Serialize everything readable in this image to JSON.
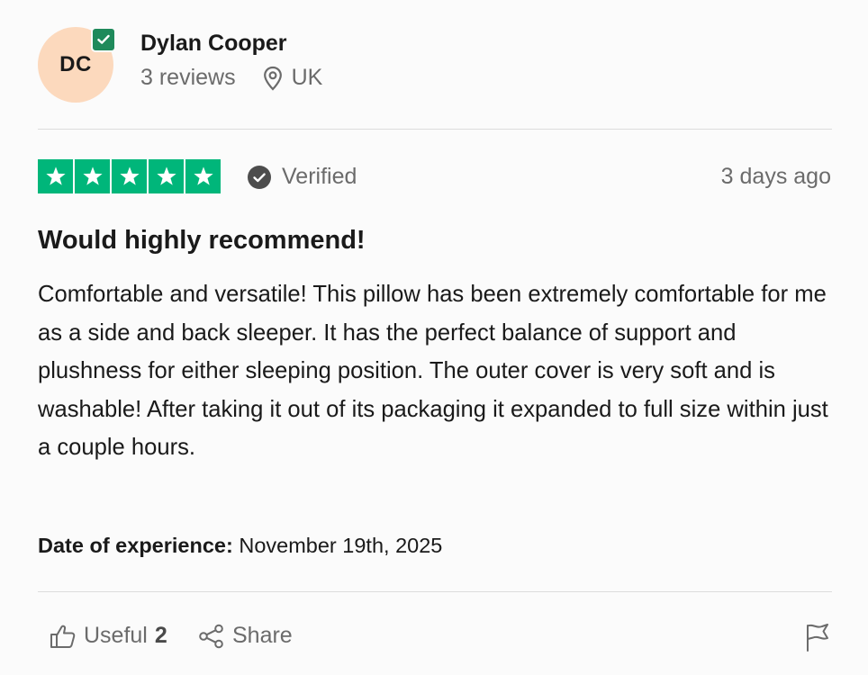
{
  "reviewer": {
    "initials": "DC",
    "name": "Dylan Cooper",
    "review_count": "3 reviews",
    "location": "UK",
    "avatar_color": "#fcd9bd",
    "badge_icon": "check-badge-icon"
  },
  "rating": {
    "stars": 5,
    "max_stars": 5,
    "star_color": "#00b67a",
    "verified_label": "Verified",
    "posted": "3 days ago"
  },
  "review": {
    "title": "Would highly recommend!",
    "body": "Comfortable and versatile! This pillow has been extremely comfortable for me as a side and back sleeper. It has the perfect balance of support and plushness for either sleeping position. The outer cover is very soft and is washable! After taking it out of its packaging it expanded to full size within just a couple hours.",
    "experience_label": "Date of experience:",
    "experience_date": "November 19th, 2025"
  },
  "actions": {
    "useful_label": "Useful",
    "useful_count": "2",
    "share_label": "Share",
    "useful_icon": "thumbs-up-icon",
    "share_icon": "share-icon",
    "flag_icon": "flag-icon"
  }
}
